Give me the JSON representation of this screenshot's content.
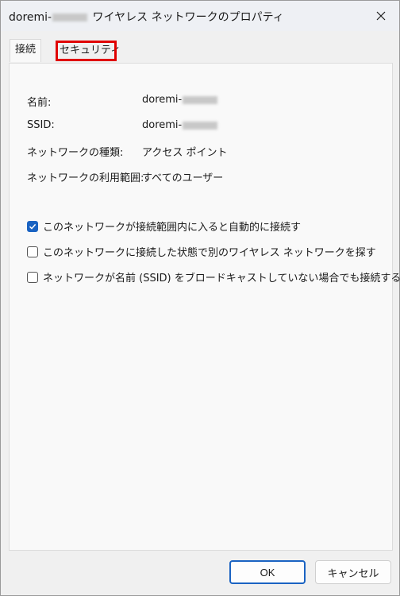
{
  "window": {
    "title_prefix": "doremi-",
    "title_suffix": " ワイヤレス ネットワークのプロパティ"
  },
  "tabs": [
    {
      "label": "接続"
    },
    {
      "label": "セキュリティ"
    }
  ],
  "properties": {
    "name_label": "名前:",
    "name_value_prefix": "doremi-",
    "ssid_label": "SSID:",
    "ssid_value_prefix": "doremi-",
    "type_label": "ネットワークの種類:",
    "type_value": "アクセス ポイント",
    "scope_label": "ネットワークの利用範囲:",
    "scope_value": "すべてのユーザー"
  },
  "options": [
    {
      "label": "このネットワークが接続範囲内に入ると自動的に接続す",
      "checked": true
    },
    {
      "label": "このネットワークに接続した状態で別のワイヤレス ネットワークを探す",
      "checked": false
    },
    {
      "label": "ネットワークが名前 (SSID) をブロードキャストしていない場合でも接続する",
      "checked": false
    }
  ],
  "buttons": {
    "ok_label": "OK",
    "cancel_label": "キャンセル"
  },
  "colors": {
    "accent": "#1a63c2",
    "highlight": "#e00000"
  }
}
